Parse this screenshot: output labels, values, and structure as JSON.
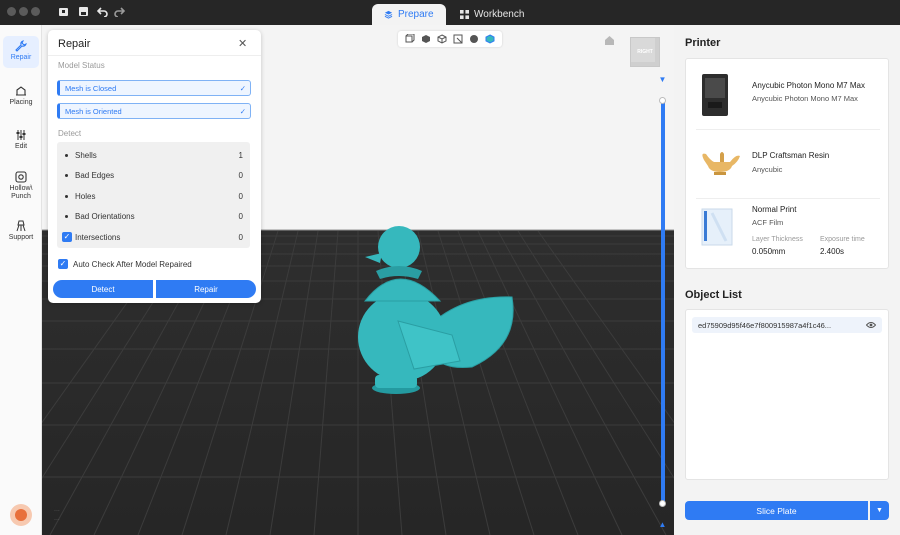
{
  "tabs": [
    {
      "label": "Prepare",
      "active": true
    },
    {
      "label": "Workbench",
      "active": false
    }
  ],
  "sidebar": {
    "items": [
      {
        "label": "Repair",
        "active": true
      },
      {
        "label": "Placing"
      },
      {
        "label": "Edit"
      },
      {
        "label_line1": "Hollow\\",
        "label_line2": "Punch"
      },
      {
        "label": "Support"
      }
    ]
  },
  "viewport": {
    "cube_label": "RIGHT",
    "footer_line1": "...",
    "footer_line2": "..."
  },
  "repair": {
    "title": "Repair",
    "model_status_label": "Model Status",
    "statuses": [
      "Mesh is Closed",
      "Mesh is Oriented"
    ],
    "detect_label": "Detect",
    "detect_rows": [
      {
        "label": "Shells",
        "value": "1"
      },
      {
        "label": "Bad Edges",
        "value": "0"
      },
      {
        "label": "Holes",
        "value": "0"
      },
      {
        "label": "Bad Orientations",
        "value": "0"
      },
      {
        "label": "Intersections",
        "value": "0",
        "checked": true
      }
    ],
    "auto_check_label": "Auto Check After Model Repaired",
    "auto_check_checked": true,
    "detect_button": "Detect",
    "repair_button": "Repair"
  },
  "printer_panel": {
    "title": "Printer",
    "printer": {
      "name": "Anycubic Photon Mono M7 Max",
      "sub": "Anycubic Photon Mono M7 Max"
    },
    "resin": {
      "name": "DLP Craftsman Resin",
      "sub": "Anycubic"
    },
    "profile": {
      "name": "Normal Print",
      "sub": "ACF Film",
      "layer_thickness_label": "Layer Thickness",
      "layer_thickness_value": "0.050mm",
      "exposure_label": "Exposure time",
      "exposure_value": "2.400s"
    }
  },
  "object_list": {
    "title": "Object List",
    "items": [
      "ed75909d95f46e7f800915987a4f1c46..."
    ]
  },
  "slice_button": "Slice Plate",
  "colors": {
    "accent": "#2f7bf3",
    "model": "#36b8bd"
  }
}
